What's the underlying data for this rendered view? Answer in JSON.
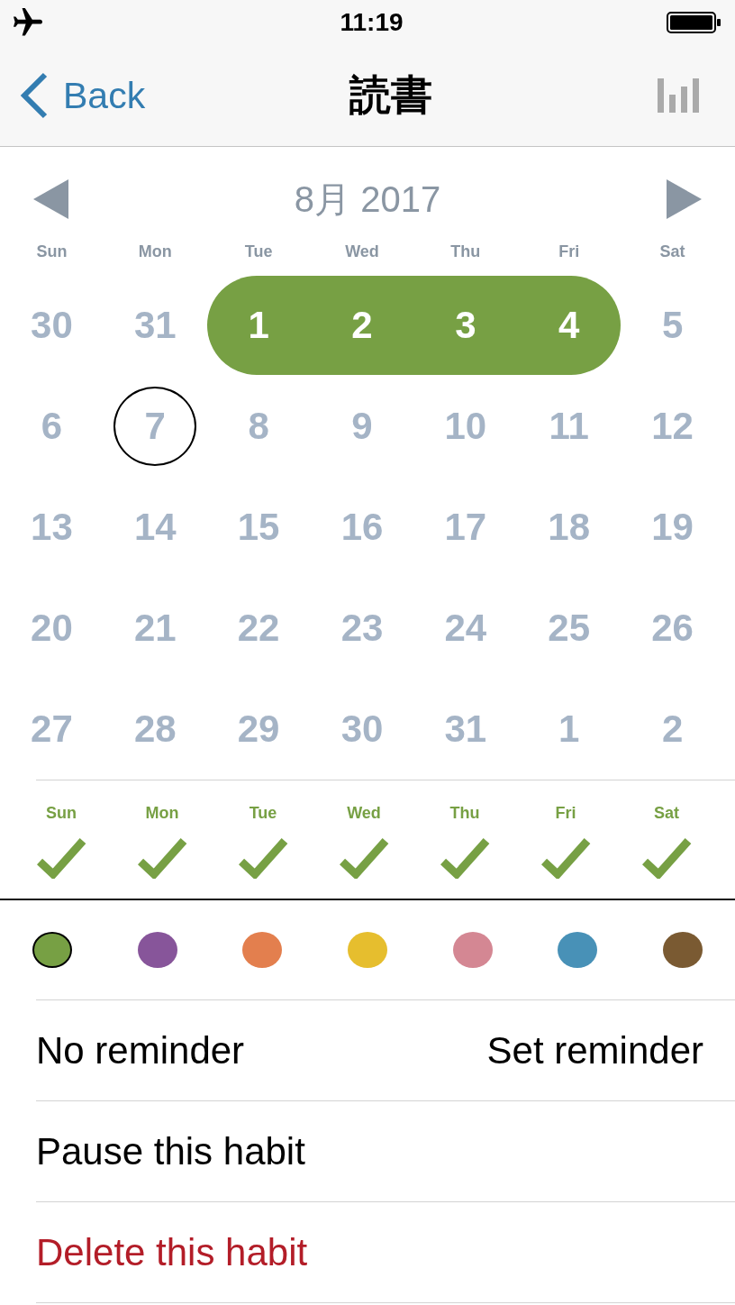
{
  "status_bar": {
    "time": "11:19"
  },
  "nav": {
    "back": "Back",
    "title": "読書"
  },
  "calendar": {
    "month": "8月 2017",
    "weekdays": [
      "Sun",
      "Mon",
      "Tue",
      "Wed",
      "Thu",
      "Fri",
      "Sat"
    ],
    "weeks": [
      {
        "days": [
          {
            "label": "30",
            "completed": false,
            "today": false
          },
          {
            "label": "31",
            "completed": false,
            "today": false
          },
          {
            "label": "1",
            "completed": true,
            "today": false
          },
          {
            "label": "2",
            "completed": true,
            "today": false
          },
          {
            "label": "3",
            "completed": true,
            "today": false
          },
          {
            "label": "4",
            "completed": true,
            "today": false
          },
          {
            "label": "5",
            "completed": false,
            "today": false
          }
        ]
      },
      {
        "days": [
          {
            "label": "6",
            "completed": false,
            "today": false
          },
          {
            "label": "7",
            "completed": false,
            "today": true
          },
          {
            "label": "8",
            "completed": false,
            "today": false
          },
          {
            "label": "9",
            "completed": false,
            "today": false
          },
          {
            "label": "10",
            "completed": false,
            "today": false
          },
          {
            "label": "11",
            "completed": false,
            "today": false
          },
          {
            "label": "12",
            "completed": false,
            "today": false
          }
        ]
      },
      {
        "days": [
          {
            "label": "13",
            "completed": false,
            "today": false
          },
          {
            "label": "14",
            "completed": false,
            "today": false
          },
          {
            "label": "15",
            "completed": false,
            "today": false
          },
          {
            "label": "16",
            "completed": false,
            "today": false
          },
          {
            "label": "17",
            "completed": false,
            "today": false
          },
          {
            "label": "18",
            "completed": false,
            "today": false
          },
          {
            "label": "19",
            "completed": false,
            "today": false
          }
        ]
      },
      {
        "days": [
          {
            "label": "20",
            "completed": false,
            "today": false
          },
          {
            "label": "21",
            "completed": false,
            "today": false
          },
          {
            "label": "22",
            "completed": false,
            "today": false
          },
          {
            "label": "23",
            "completed": false,
            "today": false
          },
          {
            "label": "24",
            "completed": false,
            "today": false
          },
          {
            "label": "25",
            "completed": false,
            "today": false
          },
          {
            "label": "26",
            "completed": false,
            "today": false
          }
        ]
      },
      {
        "days": [
          {
            "label": "27",
            "completed": false,
            "today": false
          },
          {
            "label": "28",
            "completed": false,
            "today": false
          },
          {
            "label": "29",
            "completed": false,
            "today": false
          },
          {
            "label": "30",
            "completed": false,
            "today": false
          },
          {
            "label": "31",
            "completed": false,
            "today": false
          },
          {
            "label": "1",
            "completed": false,
            "today": false
          },
          {
            "label": "2",
            "completed": false,
            "today": false
          }
        ]
      }
    ]
  },
  "schedule": {
    "days": [
      {
        "label": "Sun",
        "checked": true
      },
      {
        "label": "Mon",
        "checked": true
      },
      {
        "label": "Tue",
        "checked": true
      },
      {
        "label": "Wed",
        "checked": true
      },
      {
        "label": "Thu",
        "checked": true
      },
      {
        "label": "Fri",
        "checked": true
      },
      {
        "label": "Sat",
        "checked": true
      }
    ]
  },
  "colors": [
    {
      "color": "#77a044",
      "selected": true
    },
    {
      "color": "#87559a",
      "selected": false
    },
    {
      "color": "#e37f4e",
      "selected": false
    },
    {
      "color": "#e6be2e",
      "selected": false
    },
    {
      "color": "#d48793",
      "selected": false
    },
    {
      "color": "#4891b7",
      "selected": false
    },
    {
      "color": "#7a5a32",
      "selected": false
    }
  ],
  "rows": [
    {
      "kind": "reminder",
      "label": "No reminder",
      "action": "Set reminder"
    },
    {
      "kind": "action",
      "label": "Pause this habit"
    },
    {
      "kind": "destructive",
      "label": "Delete this habit"
    }
  ]
}
